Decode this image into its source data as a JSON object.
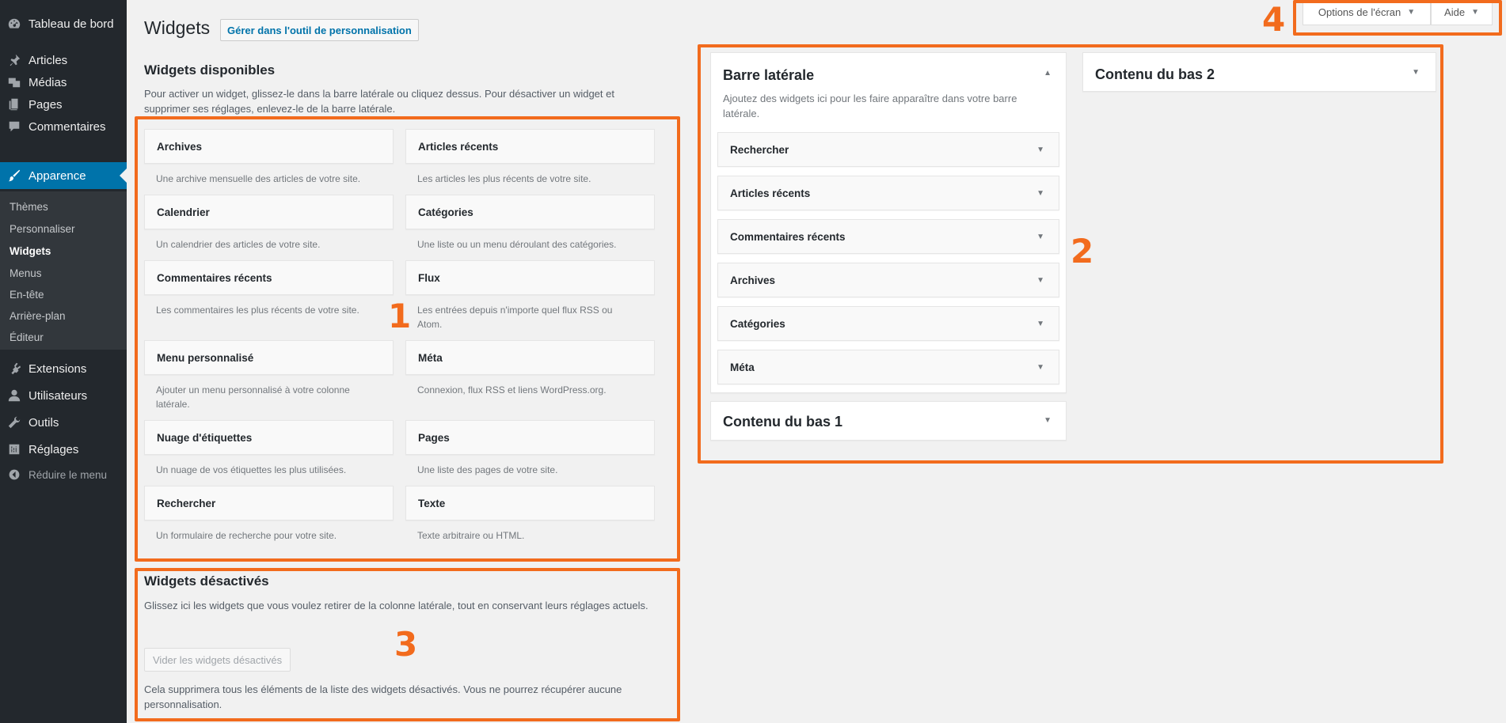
{
  "menu": {
    "items": [
      {
        "label": "Tableau de bord",
        "icon": "dashboard-icon"
      },
      {
        "label": "Articles",
        "icon": "pin-icon"
      },
      {
        "label": "Médias",
        "icon": "media-icon"
      },
      {
        "label": "Pages",
        "icon": "pages-icon"
      },
      {
        "label": "Commentaires",
        "icon": "comments-icon"
      },
      {
        "label": "Apparence",
        "icon": "brush-icon"
      },
      {
        "label": "Extensions",
        "icon": "plugin-icon"
      },
      {
        "label": "Utilisateurs",
        "icon": "user-icon"
      },
      {
        "label": "Outils",
        "icon": "wrench-icon"
      },
      {
        "label": "Réglages",
        "icon": "settings-icon"
      }
    ],
    "submenu": [
      "Thèmes",
      "Personnaliser",
      "Widgets",
      "Menus",
      "En-tête",
      "Arrière-plan",
      "Éditeur"
    ],
    "collapse": "Réduire le menu"
  },
  "header": {
    "title": "Widgets",
    "customize_button": "Gérer dans l'outil de personnalisation",
    "screen_options": "Options de l'écran",
    "help": "Aide"
  },
  "available": {
    "title": "Widgets disponibles",
    "description": "Pour activer un widget, glissez-le dans la barre latérale ou cliquez dessus. Pour désactiver un widget et supprimer ses réglages, enlevez-le de la barre latérale.",
    "widgets": [
      {
        "name": "Archives",
        "desc": "Une archive mensuelle des articles de votre site."
      },
      {
        "name": "Articles récents",
        "desc": "Les articles les plus récents de votre site."
      },
      {
        "name": "Calendrier",
        "desc": "Un calendrier des articles de votre site."
      },
      {
        "name": "Catégories",
        "desc": "Une liste ou un menu déroulant des catégories."
      },
      {
        "name": "Commentaires récents",
        "desc": "Les commentaires les plus récents de votre site."
      },
      {
        "name": "Flux",
        "desc": "Les entrées depuis n'importe quel flux RSS ou Atom."
      },
      {
        "name": "Menu personnalisé",
        "desc": "Ajouter un menu personnalisé à votre colonne latérale."
      },
      {
        "name": "Méta",
        "desc": "Connexion, flux RSS et liens WordPress.org."
      },
      {
        "name": "Nuage d'étiquettes",
        "desc": "Un nuage de vos étiquettes les plus utilisées."
      },
      {
        "name": "Pages",
        "desc": "Une liste des pages de votre site."
      },
      {
        "name": "Rechercher",
        "desc": "Un formulaire de recherche pour votre site."
      },
      {
        "name": "Texte",
        "desc": "Texte arbitraire ou HTML."
      }
    ]
  },
  "sidebar": {
    "title": "Barre latérale",
    "description": "Ajoutez des widgets ici pour les faire apparaître dans votre barre latérale.",
    "widgets": [
      "Rechercher",
      "Articles récents",
      "Commentaires récents",
      "Archives",
      "Catégories",
      "Méta"
    ]
  },
  "footer1": {
    "title": "Contenu du bas 1"
  },
  "footer2": {
    "title": "Contenu du bas 2"
  },
  "inactive": {
    "title": "Widgets désactivés",
    "description": "Glissez ici les widgets que vous voulez retirer de la colonne latérale, tout en conservant leurs réglages actuels.",
    "clear_button": "Vider les widgets désactivés",
    "note": "Cela supprimera tous les éléments de la liste des widgets désactivés. Vous ne pourrez récupérer aucune personnalisation."
  },
  "annotations": [
    "1",
    "2",
    "3",
    "4"
  ],
  "colors": {
    "accent": "#0073aa",
    "annotation": "#f26b1d",
    "menu_bg": "#23282d"
  }
}
